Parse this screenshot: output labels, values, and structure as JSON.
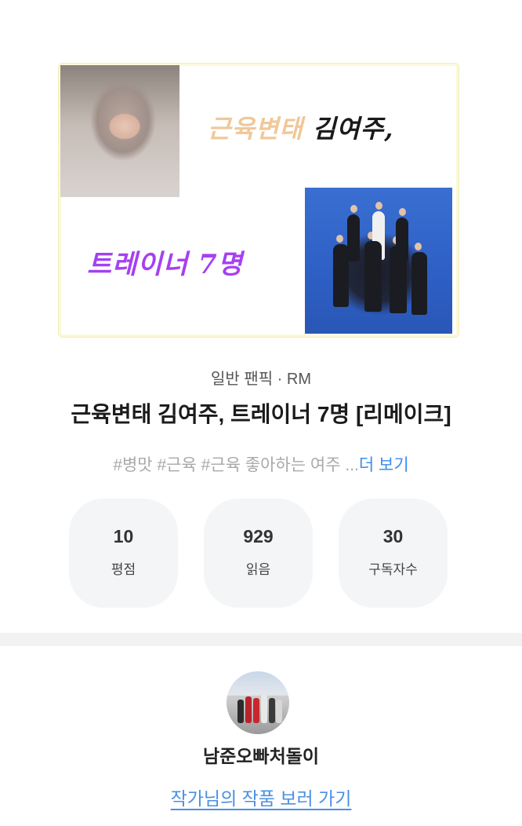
{
  "cover": {
    "text_line1_light": "근육변태",
    "text_line1_dark": "김여주,",
    "text_line2": "트레이너 7명"
  },
  "work": {
    "category": "일반 팬픽 · RM",
    "title": "근육변태 김여주, 트레이너 7명 [리메이크]",
    "tags": "#병맛 #근육 #근육 좋아하는 여주 ...",
    "more_label": "더 보기"
  },
  "stats": [
    {
      "value": "10",
      "label": "평점"
    },
    {
      "value": "929",
      "label": "읽음"
    },
    {
      "value": "30",
      "label": "구독자수"
    }
  ],
  "author": {
    "name": "남준오빠처돌이",
    "link_label": "작가님의 작품 보러 가기"
  },
  "colors": {
    "link_blue": "#4a90e2",
    "tag_more_blue": "#3d8bf0",
    "stat_bg": "#f4f5f7",
    "cover_purple_text": "#a640f2"
  }
}
